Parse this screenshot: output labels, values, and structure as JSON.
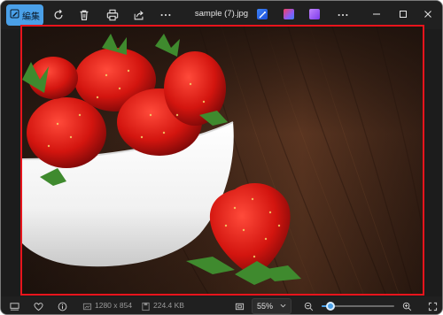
{
  "toolbar": {
    "edit_label": "編集",
    "title": "sample (7).jpg",
    "icons": [
      "rotate-icon",
      "delete-icon",
      "print-icon",
      "share-icon",
      "more-icon",
      "ai-edit-icon",
      "copilot-icon",
      "clipchamp-icon",
      "more-icon"
    ]
  },
  "image": {
    "description_icon": "photo"
  },
  "status": {
    "dimensions": "1280 x 854",
    "file_size": "224.4 KB",
    "zoom": "55%",
    "zoom_fraction": 0.12
  },
  "colors": {
    "accent": "#4aa0e8",
    "highlight_border": "#e8141c",
    "background": "#202020"
  }
}
